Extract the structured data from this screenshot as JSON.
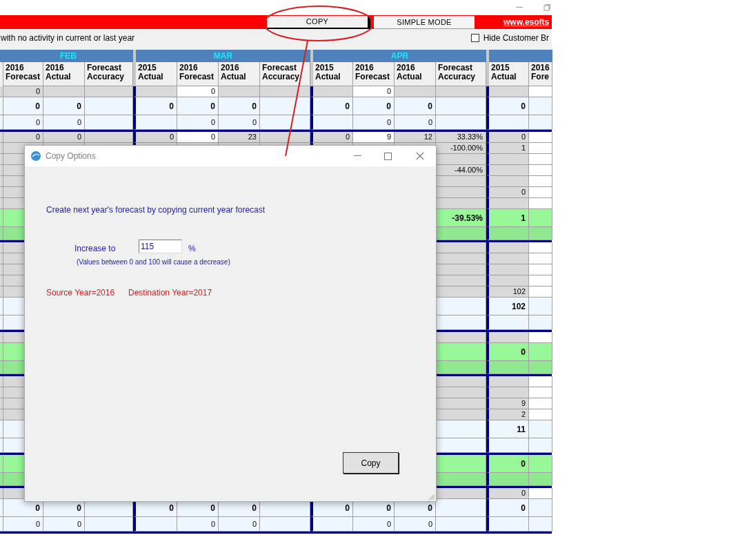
{
  "toolbar": {
    "buttons": [
      {
        "label": "COPY",
        "kind": "pressed"
      },
      {
        "label": "SIMPLE MODE",
        "kind": "plain"
      }
    ],
    "link": "www.esofts"
  },
  "filter_bar": {
    "note": "with no activity in current or last year",
    "checkbox": {
      "label": "Hide Customer Br",
      "checked": false
    }
  },
  "grid": {
    "groups": [
      {
        "month": "FEB",
        "columns": [
          "2016 Forecast",
          "2016 Actual",
          "Forecast Accuracy"
        ]
      },
      {
        "month": "MAR",
        "columns": [
          "2015 Actual",
          "2016 Forecast",
          "2016 Actual",
          "Forecast Accuracy"
        ]
      },
      {
        "month": "APR",
        "columns": [
          "2015 Actual",
          "2016 Forecast",
          "2016 Actual",
          "Forecast Accuracy"
        ]
      },
      {
        "columns": [
          "2015 Actual",
          "2016 Fore"
        ]
      }
    ],
    "rows": [
      {
        "kind": "detail",
        "cells": [
          "0",
          "",
          "",
          "",
          {
            "text": "0",
            "editable": true
          },
          "",
          "",
          "",
          {
            "text": "0",
            "editable": true
          },
          "",
          "",
          "",
          {
            "text": "",
            "editable": true
          }
        ]
      },
      {
        "kind": "total",
        "cells": [
          "0",
          "0",
          "",
          "0",
          "0",
          "0",
          "",
          "0",
          "0",
          "0",
          "",
          "0",
          ""
        ]
      },
      {
        "kind": "subtotal",
        "cells": [
          "0",
          "0",
          "",
          "",
          "0",
          "0",
          "",
          "",
          "0",
          "0",
          "",
          "",
          ""
        ]
      },
      {
        "kind": "detail",
        "cells": [
          "0",
          "0",
          "",
          "0",
          {
            "text": "0",
            "editable": true
          },
          "23",
          "",
          "0",
          {
            "text": "9",
            "editable": true
          },
          "12",
          "33.33%",
          "0",
          {
            "text": "",
            "editable": true
          }
        ]
      },
      {
        "kind": "detail",
        "cells": [
          "",
          "",
          "",
          "",
          "",
          "",
          "",
          "",
          "",
          "",
          "-100.00%",
          "1",
          {
            "text": "",
            "editable": true
          }
        ]
      },
      {
        "kind": "detail",
        "cells": [
          "",
          "",
          "",
          "",
          "",
          "",
          "",
          "",
          "",
          "",
          "",
          "",
          {
            "text": "",
            "editable": true
          }
        ]
      },
      {
        "kind": "detail",
        "cells": [
          "",
          "",
          "",
          "",
          "",
          "",
          "",
          "",
          "",
          "",
          "-44.00%",
          "",
          {
            "text": "",
            "editable": true
          }
        ]
      },
      {
        "kind": "detail",
        "cells": [
          "",
          "",
          "",
          "",
          "",
          "",
          "",
          "",
          "",
          "",
          "",
          "",
          {
            "text": "",
            "editable": true
          }
        ]
      },
      {
        "kind": "detail",
        "cells": [
          "",
          "",
          "",
          "",
          "",
          "",
          "",
          "",
          "",
          "",
          "",
          "0",
          {
            "text": "",
            "editable": true
          }
        ]
      },
      {
        "kind": "detail",
        "cells": [
          "",
          "",
          "",
          "",
          "",
          "",
          "",
          "",
          "",
          "",
          "",
          "",
          {
            "text": "",
            "editable": true
          }
        ]
      },
      {
        "kind": "green_total",
        "cells": [
          "",
          "",
          "",
          "",
          "",
          "",
          "",
          "",
          "",
          "",
          "-39.53%",
          "1",
          ""
        ]
      },
      {
        "kind": "green_sub",
        "cells": [
          "",
          "",
          "",
          "",
          "",
          "",
          "",
          "",
          "",
          "",
          "",
          "",
          ""
        ]
      },
      {
        "kind": "detail",
        "cells": [
          "",
          "",
          "",
          "",
          "",
          "",
          "",
          "",
          "",
          "",
          "",
          "",
          {
            "text": "",
            "editable": true
          }
        ]
      },
      {
        "kind": "detail",
        "cells": [
          "",
          "",
          "",
          "",
          "",
          "",
          "",
          "",
          "",
          "",
          "",
          "",
          {
            "text": "",
            "editable": true
          }
        ]
      },
      {
        "kind": "detail",
        "cells": [
          "",
          "",
          "",
          "",
          "",
          "",
          "",
          "",
          "",
          "",
          "",
          "",
          {
            "text": "",
            "editable": true
          }
        ]
      },
      {
        "kind": "detail",
        "cells": [
          "",
          "",
          "",
          "",
          "",
          "",
          "",
          "",
          "",
          "",
          "",
          "",
          {
            "text": "",
            "editable": true
          }
        ]
      },
      {
        "kind": "detail",
        "cells": [
          "",
          "",
          "",
          "",
          "",
          "",
          "",
          "",
          "",
          "",
          "",
          "102",
          {
            "text": "",
            "editable": true
          }
        ]
      },
      {
        "kind": "total",
        "cells": [
          "",
          "",
          "",
          "",
          "",
          "",
          "",
          "",
          "",
          "",
          "",
          "102",
          ""
        ]
      },
      {
        "kind": "subtotal",
        "cells": [
          "",
          "",
          "",
          "",
          "",
          "",
          "",
          "",
          "",
          "",
          "",
          "",
          ""
        ]
      },
      {
        "kind": "detail",
        "cells": [
          "",
          "",
          "",
          "",
          "",
          "",
          "",
          "",
          "",
          "",
          "",
          "",
          {
            "text": "",
            "editable": true
          }
        ]
      },
      {
        "kind": "green_total",
        "cells": [
          "",
          "",
          "",
          "",
          "",
          "",
          "",
          "",
          "",
          "",
          "",
          "0",
          ""
        ]
      },
      {
        "kind": "green_sub",
        "cells": [
          "",
          "",
          "",
          "",
          "",
          "",
          "",
          "",
          "",
          "",
          "",
          "",
          ""
        ]
      },
      {
        "kind": "detail",
        "cells": [
          "",
          "",
          "",
          "",
          "",
          "",
          "",
          "",
          "",
          "",
          "",
          "",
          {
            "text": "",
            "editable": true
          }
        ]
      },
      {
        "kind": "detail",
        "cells": [
          "",
          "",
          "",
          "",
          "",
          "",
          "",
          "",
          "",
          "",
          "",
          "",
          {
            "text": "",
            "editable": true
          }
        ]
      },
      {
        "kind": "detail",
        "cells": [
          "",
          "",
          "",
          "",
          "",
          "",
          "",
          "",
          "",
          "",
          "",
          "9",
          {
            "text": "",
            "editable": true
          }
        ]
      },
      {
        "kind": "detail",
        "cells": [
          "",
          "",
          "",
          "",
          "",
          "",
          "",
          "",
          "",
          "",
          "",
          "2",
          {
            "text": "",
            "editable": true
          }
        ]
      },
      {
        "kind": "total",
        "cells": [
          "",
          "",
          "",
          "",
          "",
          "",
          "",
          "",
          "",
          "",
          "",
          "11",
          ""
        ]
      },
      {
        "kind": "subtotal",
        "cells": [
          "",
          "",
          "",
          "",
          "",
          "",
          "",
          "",
          "",
          "",
          "",
          "",
          ""
        ]
      },
      {
        "kind": "green_total",
        "cells": [
          "",
          "",
          "",
          "",
          "",
          "",
          "",
          "",
          "",
          "",
          "",
          "0",
          ""
        ]
      },
      {
        "kind": "green_sub",
        "cells": [
          "",
          "",
          "",
          "",
          "",
          "",
          "",
          "",
          "",
          "",
          "",
          "",
          ""
        ]
      },
      {
        "kind": "detail",
        "cells": [
          "",
          "",
          "",
          "",
          "",
          "",
          "",
          "",
          "",
          "",
          "",
          "0",
          {
            "text": "",
            "editable": true
          }
        ]
      },
      {
        "kind": "total",
        "cells": [
          "0",
          "0",
          "",
          "0",
          "0",
          "0",
          "",
          "0",
          "0",
          "0",
          "",
          "0",
          ""
        ]
      },
      {
        "kind": "subtotal",
        "cells": [
          "0",
          "0",
          "",
          "",
          "0",
          "0",
          "",
          "",
          "0",
          "0",
          "",
          "",
          ""
        ]
      }
    ]
  },
  "dialog": {
    "title": "Copy Options",
    "instruction": "Create next year's forecast by copying current year forecast",
    "increase_label": "Increase to",
    "increase_value": "115",
    "unit": "%",
    "hint": "(Values between 0 and 100 will cause a decrease)",
    "source": "Source Year=2016",
    "destination": "Destination Year=2017",
    "button": "Copy"
  }
}
